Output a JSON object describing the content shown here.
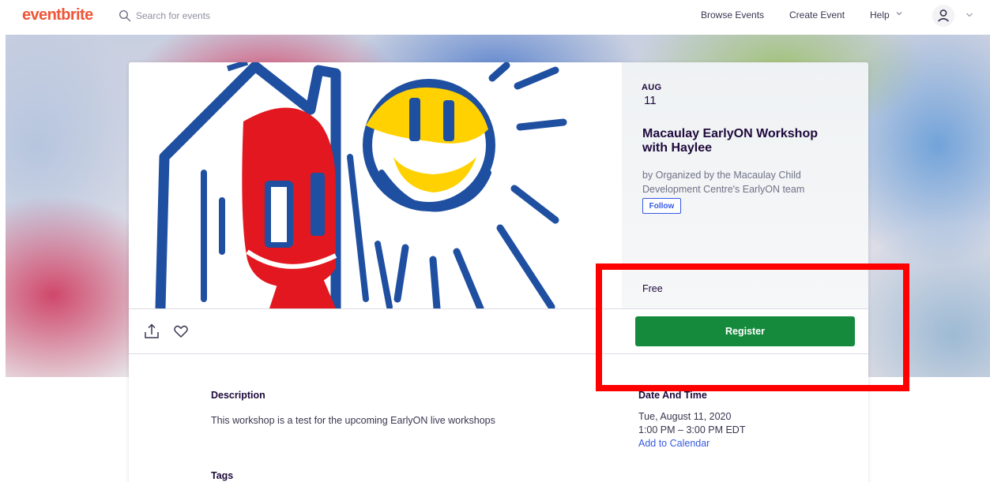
{
  "app": {
    "logo_text": "eventbrite"
  },
  "header": {
    "search_placeholder": "Search for events",
    "nav": {
      "browse": "Browse Events",
      "create": "Create Event",
      "help": "Help"
    }
  },
  "event": {
    "month": "AUG",
    "day": "11",
    "title": "Macaulay EarlyON Workshop with Haylee",
    "organizer": "by Organized by the Macaulay Child Development Centre's EarlyON team",
    "follow_label": "Follow",
    "price": "Free",
    "register_label": "Register"
  },
  "details": {
    "description_heading": "Description",
    "description_text": "This workshop is a test for the upcoming EarlyON live workshops",
    "tags_heading": "Tags",
    "datetime_heading": "Date And Time",
    "date": "Tue, August 11, 2020",
    "time": "1:00 PM – 3:00 PM EDT",
    "add_to_calendar": "Add to Calendar"
  },
  "colors": {
    "brand": "#f05537",
    "register_green": "#168a3c",
    "link_blue": "#3659e3",
    "highlight_red": "#ff0000"
  },
  "icons": [
    "search-icon",
    "chevron-down-icon",
    "user-avatar-icon",
    "share-icon",
    "heart-icon"
  ]
}
